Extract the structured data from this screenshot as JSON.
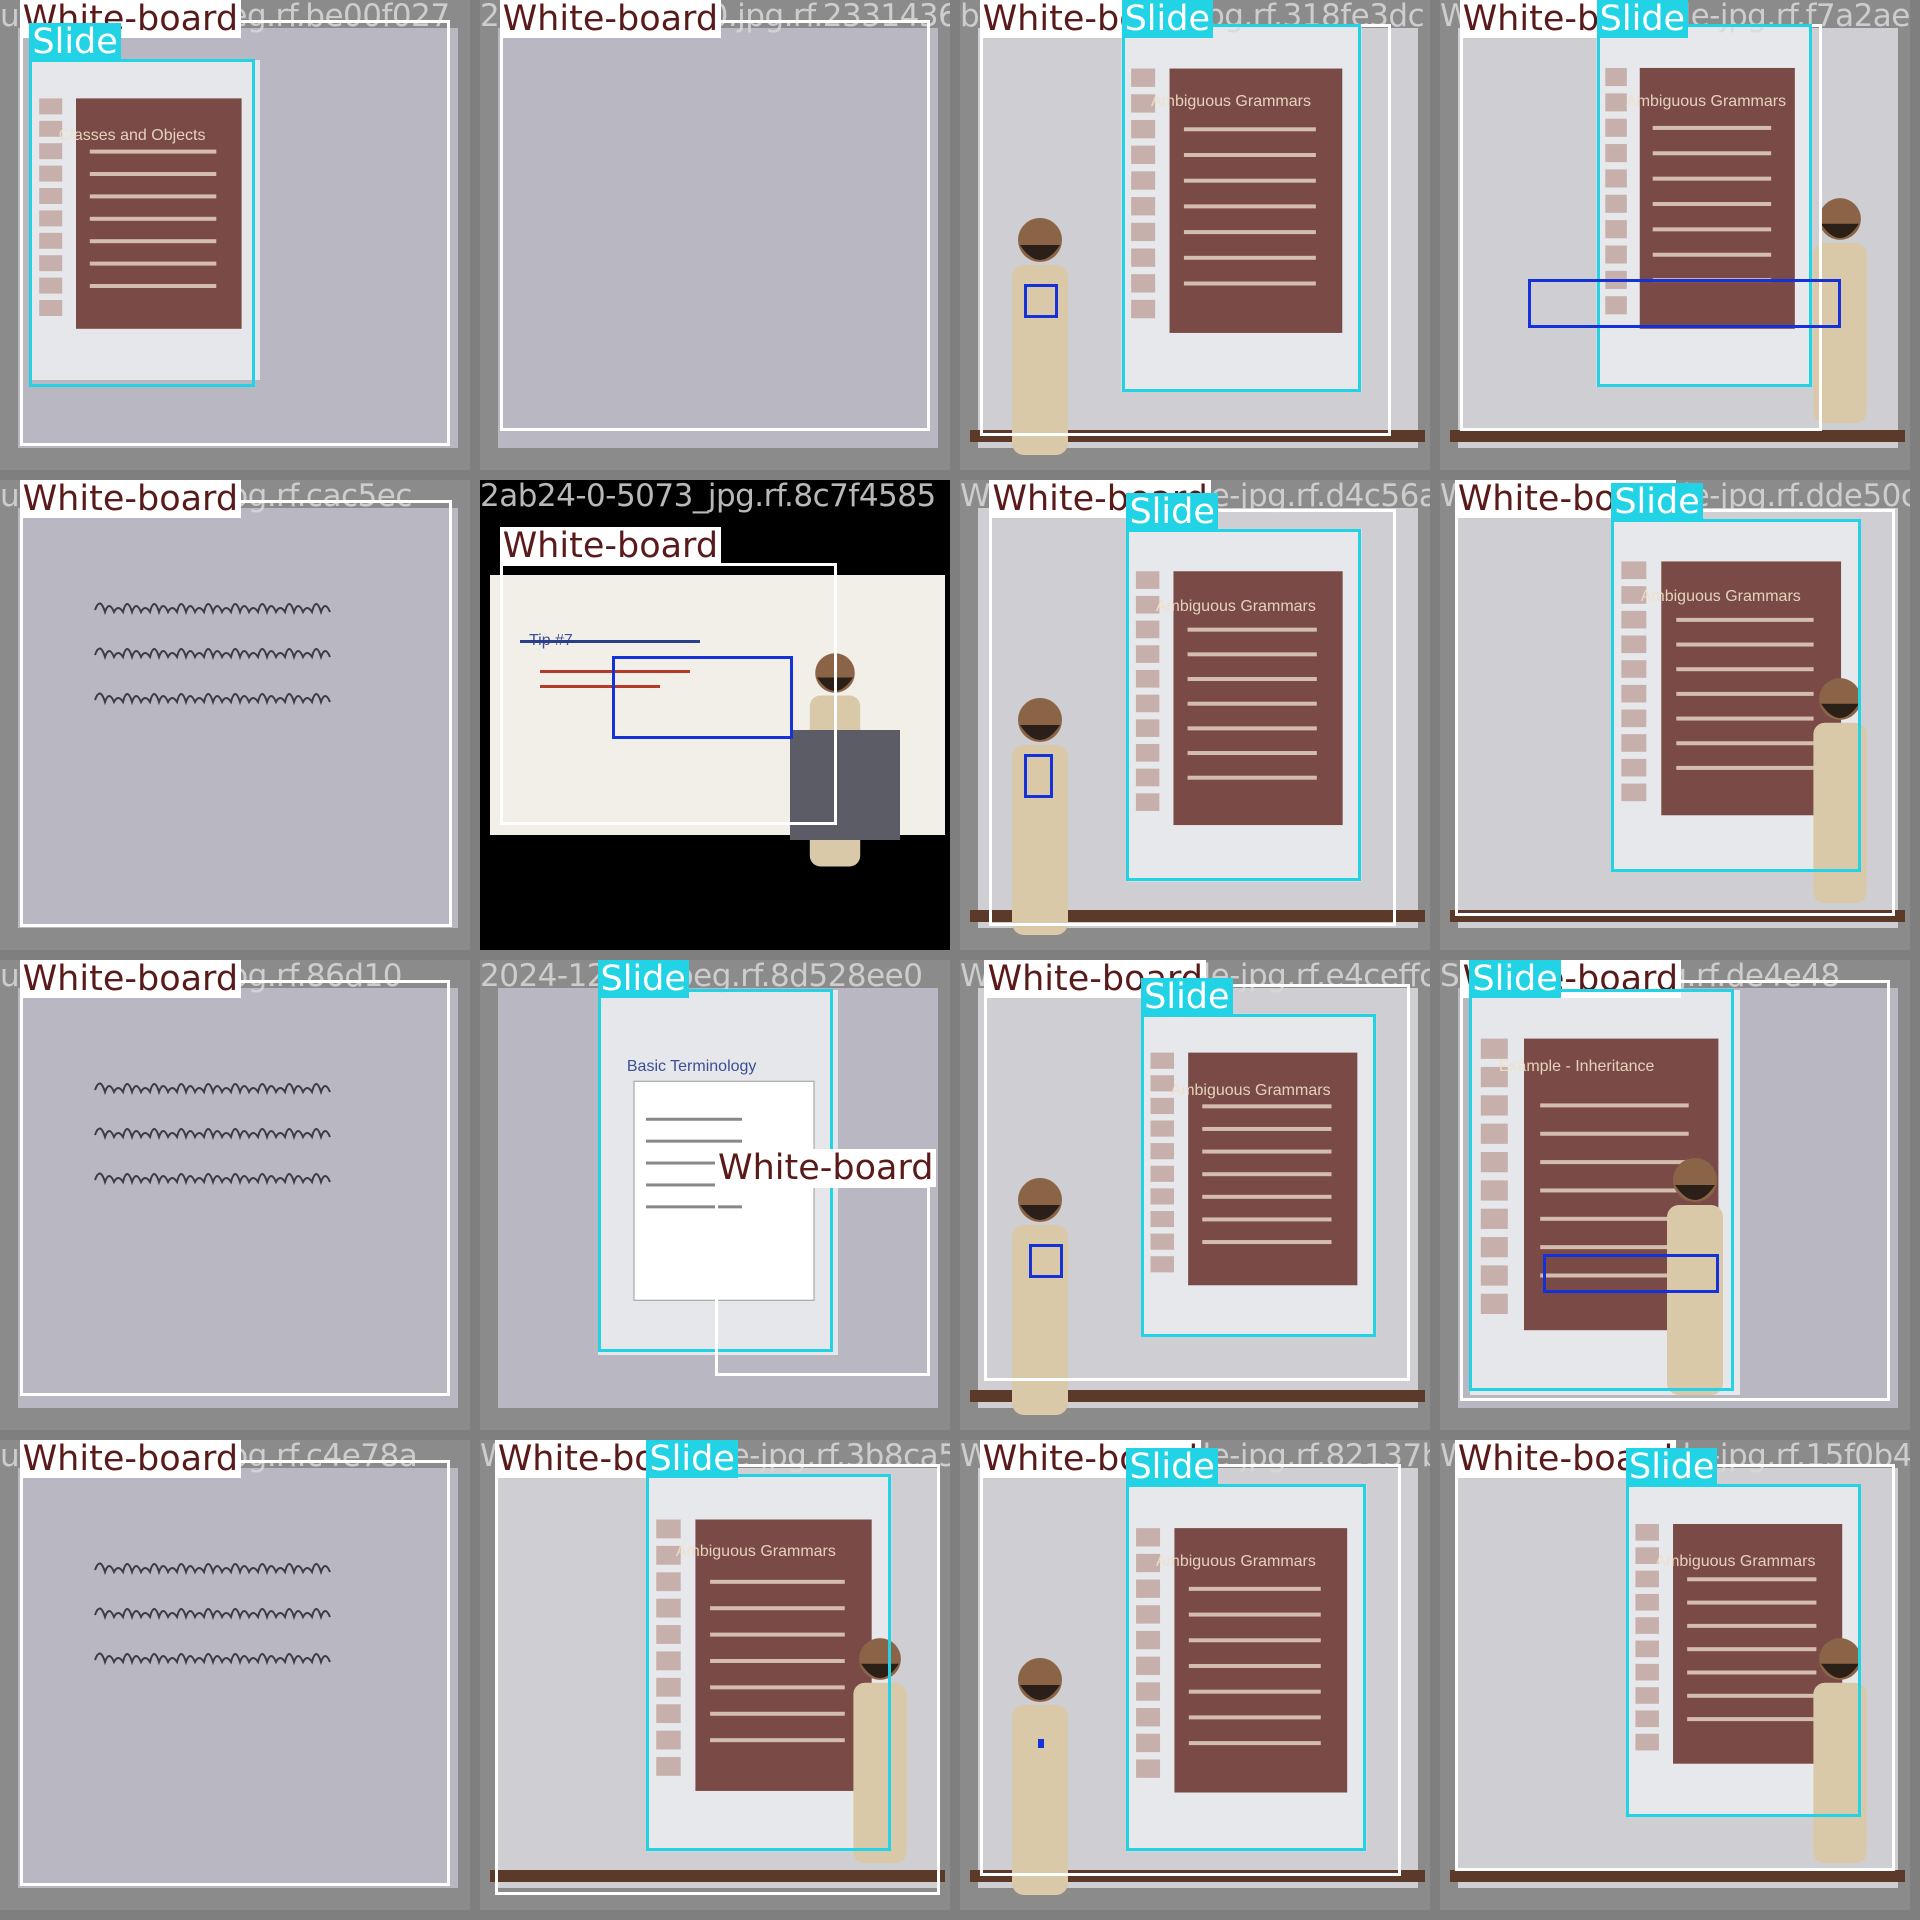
{
  "labels": {
    "whiteboard": "White-board",
    "slide": "Slide",
    "instructor": "Instructor"
  },
  "colors": {
    "whiteboard": "#ffffff",
    "whiteboard_text": "#5b1a1a",
    "slide": "#22d3e6",
    "instructor": "#1432d8",
    "background": "#7f7f7f"
  },
  "tiles": [
    {
      "filename": "untitle-0-64-_jpeg.rf.be00f027",
      "scene": "projector",
      "slide_text": "Classes and Objects",
      "boxes": [
        {
          "cls": "whiteboard",
          "b": [
            20,
            20,
            460,
            455
          ]
        },
        {
          "cls": "slide",
          "b": [
            30,
            60,
            260,
            395
          ]
        }
      ]
    },
    {
      "filename": "2024-12-01_160.jpg.rf.23314362",
      "scene": "blank",
      "boxes": [
        {
          "cls": "whiteboard",
          "b": [
            20,
            20,
            460,
            440
          ]
        }
      ]
    },
    {
      "filename": "bf058-3cf-Slide-jpg.rf.318fe3dc",
      "scene": "lecture",
      "slide_text": "Ambiguous Grammars",
      "boxes": [
        {
          "cls": "whiteboard",
          "b": [
            20,
            25,
            440,
            445
          ]
        },
        {
          "cls": "slide",
          "b": [
            165,
            25,
            410,
            400
          ]
        },
        {
          "cls": "instr",
          "b": [
            65,
            290,
            100,
            325
          ]
        }
      ]
    },
    {
      "filename": "White-board-Slide-jpg.rf.f7a2ae7",
      "scene": "lecture2",
      "slide_text": "Ambiguous Grammars",
      "boxes": [
        {
          "cls": "whiteboard",
          "b": [
            20,
            25,
            390,
            440
          ]
        },
        {
          "cls": "slide",
          "b": [
            160,
            25,
            380,
            395
          ]
        },
        {
          "cls": "instr",
          "b": [
            90,
            285,
            410,
            335
          ]
        }
      ]
    },
    {
      "filename": "untitle-0-658-_jpg.rf.cac5ec",
      "scene": "handwriting",
      "boxes": [
        {
          "cls": "whiteboard",
          "b": [
            20,
            20,
            462,
            457
          ]
        }
      ]
    },
    {
      "filename": "2ab24-0-5073_jpg.rf.8c7f4585",
      "scene": "tip",
      "slide_text": "Tip #7",
      "boxes": [
        {
          "cls": "whiteboard",
          "b": [
            20,
            85,
            365,
            352
          ]
        },
        {
          "cls": "instr",
          "b": [
            135,
            180,
            320,
            265
          ]
        }
      ]
    },
    {
      "filename": "White-board-Slide-jpg.rf.d4c56a2",
      "scene": "lecture",
      "slide_text": "Ambiguous Grammars",
      "boxes": [
        {
          "cls": "whiteboard",
          "b": [
            30,
            30,
            445,
            455
          ]
        },
        {
          "cls": "slide",
          "b": [
            170,
            50,
            410,
            410
          ]
        },
        {
          "cls": "instr",
          "b": [
            65,
            280,
            95,
            325
          ]
        }
      ]
    },
    {
      "filename": "White-board-Slide-jpg.rf.dde50c",
      "scene": "lecture2",
      "slide_text": "Ambiguous Grammars",
      "boxes": [
        {
          "cls": "whiteboard",
          "b": [
            15,
            30,
            465,
            445
          ]
        },
        {
          "cls": "slide",
          "b": [
            175,
            40,
            430,
            400
          ]
        }
      ]
    },
    {
      "filename": "untitle-0-658-_jpg.rf.86d10",
      "scene": "handwriting",
      "boxes": [
        {
          "cls": "whiteboard",
          "b": [
            20,
            20,
            460,
            445
          ]
        }
      ]
    },
    {
      "filename": "2024-12-05-jpeg.rf.8d528ee0",
      "scene": "terminology",
      "slide_text": "Basic Terminology",
      "boxes": [
        {
          "cls": "slide",
          "b": [
            120,
            30,
            360,
            400
          ]
        },
        {
          "cls": "whiteboard",
          "b": [
            240,
            230,
            460,
            425
          ]
        }
      ]
    },
    {
      "filename": "White-board-Slide-jpg.rf.e4ceffc5",
      "scene": "lecture",
      "slide_text": "Ambiguous Grammars",
      "boxes": [
        {
          "cls": "whiteboard",
          "b": [
            25,
            25,
            460,
            430
          ]
        },
        {
          "cls": "slide",
          "b": [
            185,
            55,
            425,
            385
          ]
        },
        {
          "cls": "instr",
          "b": [
            70,
            290,
            105,
            325
          ]
        }
      ]
    },
    {
      "filename": "Slide-board-jpeg.rf.de4e48",
      "scene": "inheritance",
      "slide_text": "Example - Inheritance",
      "boxes": [
        {
          "cls": "whiteboard",
          "b": [
            20,
            20,
            460,
            450
          ]
        },
        {
          "cls": "slide",
          "b": [
            30,
            30,
            300,
            440
          ]
        },
        {
          "cls": "instr",
          "b": [
            105,
            300,
            285,
            340
          ]
        }
      ]
    },
    {
      "filename": "untitle-0-623-_jpg.rf.c4e78a",
      "scene": "handwriting",
      "boxes": [
        {
          "cls": "whiteboard",
          "b": [
            20,
            20,
            460,
            455
          ]
        }
      ]
    },
    {
      "filename": "White-board-Slide-jpg.rf.3b8ca5a",
      "scene": "lecture2",
      "slide_text": "Ambiguous Grammars",
      "boxes": [
        {
          "cls": "whiteboard",
          "b": [
            15,
            25,
            470,
            465
          ]
        },
        {
          "cls": "slide",
          "b": [
            170,
            35,
            420,
            420
          ]
        }
      ]
    },
    {
      "filename": "White-board-Slide-jpg.rf.82137bb",
      "scene": "lecture",
      "slide_text": "Ambiguous Grammars",
      "boxes": [
        {
          "cls": "whiteboard",
          "b": [
            20,
            25,
            450,
            445
          ]
        },
        {
          "cls": "slide",
          "b": [
            170,
            45,
            415,
            420
          ]
        },
        {
          "cls": "instr",
          "b": [
            80,
            305,
            85,
            315
          ]
        }
      ]
    },
    {
      "filename": "White-board-Slide-jpg.rf.15f0b4b",
      "scene": "lecture2",
      "slide_text": "Ambiguous Grammars",
      "boxes": [
        {
          "cls": "whiteboard",
          "b": [
            15,
            25,
            465,
            440
          ]
        },
        {
          "cls": "slide",
          "b": [
            190,
            45,
            430,
            385
          ]
        }
      ]
    }
  ]
}
